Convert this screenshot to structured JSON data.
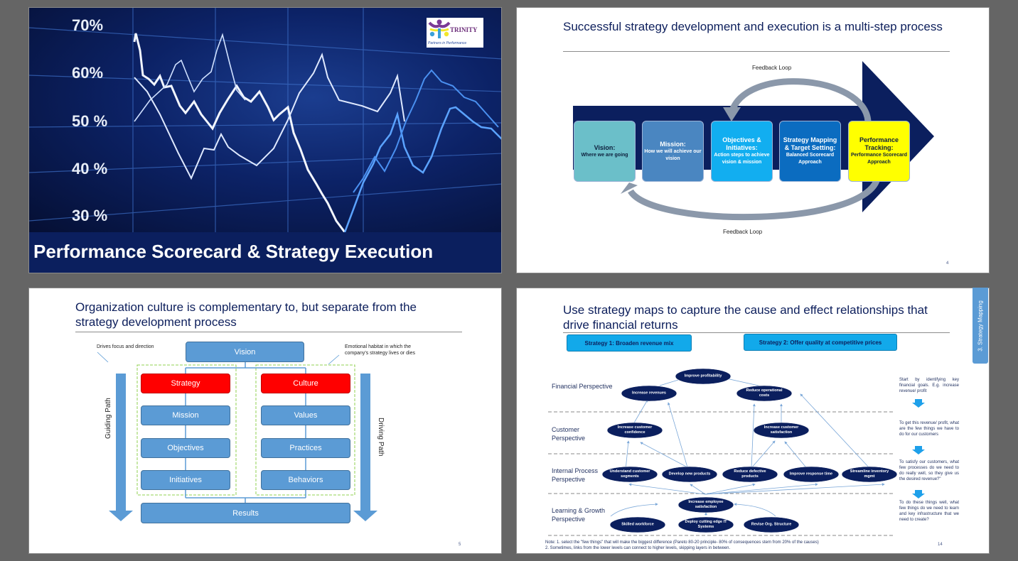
{
  "slides": [
    {
      "title": "Performance Scorecard & Strategy Execution",
      "chart_labels": [
        "70%",
        "60%",
        "50 %",
        "40 %",
        "30 %"
      ],
      "logo": {
        "name": "TRINITY",
        "tagline": "Partners in Performance"
      }
    },
    {
      "title": "Successful strategy development and execution is a multi-step process",
      "feedback_top": "Feedback Loop",
      "feedback_bottom": "Feedback Loop",
      "steps": [
        {
          "heading": "Vision:",
          "detail": "Where we are going",
          "color": "#6bbfc9"
        },
        {
          "heading": "Mission:",
          "detail": "How we will achieve our vision",
          "color": "#4a86c1"
        },
        {
          "heading": "Objectives & Initiatives:",
          "detail": "Action steps to achieve vision & mission",
          "color": "#12aef0"
        },
        {
          "heading": "Strategy Mapping & Target Setting:",
          "detail": "Balanced Scorecard Approach",
          "color": "#0b6cc0"
        },
        {
          "heading": "Performance Tracking:",
          "detail": "Performance Scorecard Approach",
          "color": "#ffff00"
        }
      ],
      "page_number": "4"
    },
    {
      "title": "Organization culture is complementary to, but separate from the strategy development process",
      "vision": "Vision",
      "note_left": "Drives focus and direction",
      "note_right": "Emotional habitat in which the company's strategy lives or dies",
      "strategy_column": [
        "Strategy",
        "Mission",
        "Objectives",
        "Initiatives"
      ],
      "culture_column": [
        "Culture",
        "Values",
        "Practices",
        "Behaviors"
      ],
      "results": "Results",
      "guiding_path": "Guiding Path",
      "driving_path": "Driving Path",
      "page_number": "5"
    },
    {
      "title": "Use strategy maps to capture the cause and effect relationships that drive financial returns",
      "strategy1": "Strategy 1: Broaden revenue mix",
      "strategy2": "Strategy 2: Offer quality at competitive prices",
      "side_tab": "3. Strategy Mapping",
      "perspectives": [
        "Financial Perspective",
        "Customer Perspective",
        "Internal Process Perspective",
        "Learning & Growth Perspective"
      ],
      "nodes": {
        "improve_profitability": "Improve profitability",
        "increase_revenues": "Increase revenues",
        "reduce_costs": "Reduce operational costs",
        "customer_confidence": "Increase customer confidence",
        "customer_satisfaction": "Increase customer satisfaction",
        "understand_segments": "Understand customer segments",
        "develop_products": "Develop new products",
        "reduce_defects": "Reduce defective products",
        "improve_response": "Improve response time",
        "streamline_inventory": "Streamline inventory mgmt",
        "employee_satisfaction": "Increase employee satisfaction",
        "skilled_workforce": "Skilled workforce",
        "deploy_it": "Deploy cutting edge IT Systems",
        "revise_structure": "Revise Org. Structure"
      },
      "side_notes": [
        "Start by identifying key financial goals. E.g. increase revenue/ profit",
        "To get this revenue/ profit, what are the few things we have to do for our customers",
        "To satisfy our customers, what few processes do we need to do really well, so they give us the desired revenue?\"",
        "To do these things well, what few things do we need to learn and key infrastructure that we need to create?"
      ],
      "note1": "Note: 1. select the \"few things\" that will make the biggest difference (Pareto 80-20 principle- 80% of consequences stem from 20% of the causes)",
      "note2": "2. Sometimes, links from the lower levels can connect to higher levels, skipping layers in between.",
      "page_number": "14"
    }
  ]
}
